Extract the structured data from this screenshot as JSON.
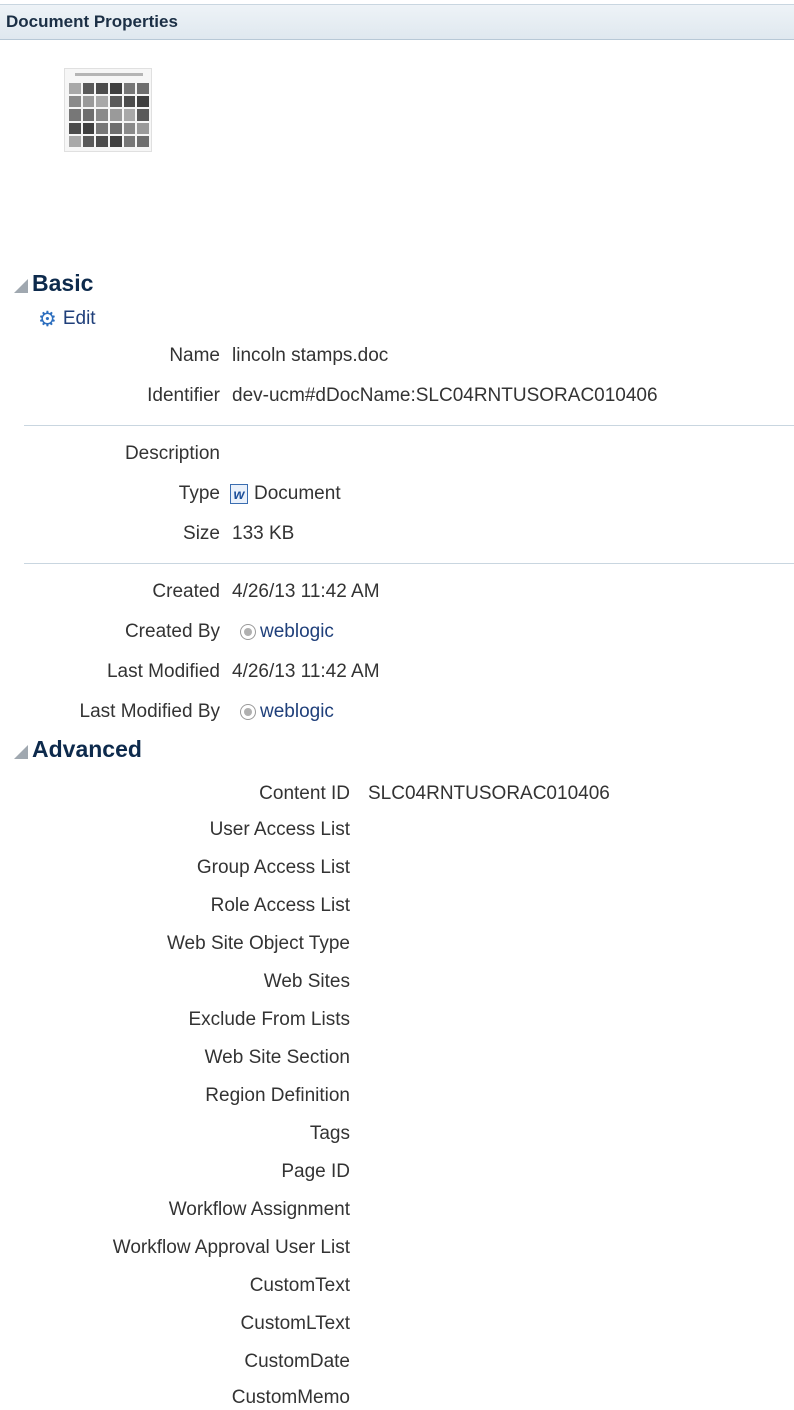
{
  "header": {
    "title": "Document Properties"
  },
  "thumbnail": {
    "alt": "document thumbnail"
  },
  "basic": {
    "title": "Basic",
    "edit_label": "Edit",
    "fields": {
      "name": {
        "label": "Name",
        "value": "lincoln stamps.doc"
      },
      "identifier": {
        "label": "Identifier",
        "value": "dev-ucm#dDocName:SLC04RNTUSORAC010406"
      },
      "description": {
        "label": "Description",
        "value": ""
      },
      "type": {
        "label": "Type",
        "value": "Document"
      },
      "size": {
        "label": "Size",
        "value": "133 KB"
      },
      "created": {
        "label": "Created",
        "value": "4/26/13 11:42 AM"
      },
      "created_by": {
        "label": "Created By",
        "value": "weblogic"
      },
      "last_modified": {
        "label": "Last Modified",
        "value": "4/26/13 11:42 AM"
      },
      "last_modified_by": {
        "label": "Last Modified By",
        "value": "weblogic"
      }
    }
  },
  "advanced": {
    "title": "Advanced",
    "fields": {
      "content_id": {
        "label": "Content ID",
        "value": "SLC04RNTUSORAC010406"
      },
      "user_access_list": {
        "label": "User Access List",
        "value": ""
      },
      "group_access_list": {
        "label": "Group Access List",
        "value": ""
      },
      "role_access_list": {
        "label": "Role Access List",
        "value": ""
      },
      "web_site_object_type": {
        "label": "Web Site Object Type",
        "value": ""
      },
      "web_sites": {
        "label": "Web Sites",
        "value": ""
      },
      "exclude_from_lists": {
        "label": "Exclude From Lists",
        "value": ""
      },
      "web_site_section": {
        "label": "Web Site Section",
        "value": ""
      },
      "region_definition": {
        "label": "Region Definition",
        "value": ""
      },
      "tags": {
        "label": "Tags",
        "value": ""
      },
      "page_id": {
        "label": "Page ID",
        "value": ""
      },
      "workflow_assignment": {
        "label": "Workflow Assignment",
        "value": ""
      },
      "workflow_approval_user_list": {
        "label": "Workflow Approval User List",
        "value": ""
      },
      "custom_text": {
        "label": "CustomText",
        "value": ""
      },
      "custom_ltext": {
        "label": "CustomLText",
        "value": ""
      },
      "custom_date": {
        "label": "CustomDate",
        "value": ""
      },
      "custom_memo": {
        "label": "CustomMemo",
        "value": ""
      }
    }
  },
  "colors": {
    "link": "#1f3f7a",
    "section_title": "#0d2a4c",
    "header_bg": "#dfe8ef"
  }
}
